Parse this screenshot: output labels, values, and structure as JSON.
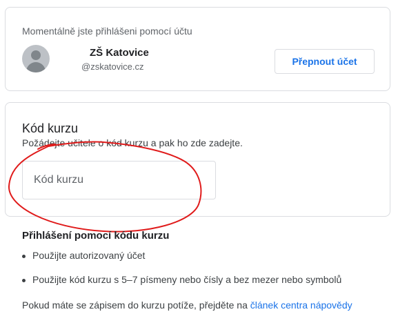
{
  "account": {
    "caption": "Momentálně jste přihlášeni pomocí účtu",
    "name": "ZŠ Katovice",
    "email": "@zskatovice.cz",
    "switch_label": "Přepnout účet"
  },
  "course_code": {
    "title": "Kód kurzu",
    "help": "Požádejte učitele o kód kurzu a pak ho zde zadejte.",
    "input_value": "",
    "input_placeholder": "Kód kurzu"
  },
  "annotation": {
    "color": "#e01b1b",
    "shape": "hand-drawn-circle"
  },
  "info": {
    "title": "Přihlášení pomocí kódu kurzu",
    "items": [
      "Použijte autorizovaný účet",
      "Použijte kód kurzu s 5–7 písmeny nebo čísly a bez mezer nebo symbolů"
    ],
    "footer_prefix": "Pokud máte se zápisem do kurzu potíže, přejděte na",
    "footer_link": "článek centra nápovědy"
  },
  "colors": {
    "accent": "#1a73e8",
    "border": "#dadce0",
    "text": "#3c4043"
  }
}
